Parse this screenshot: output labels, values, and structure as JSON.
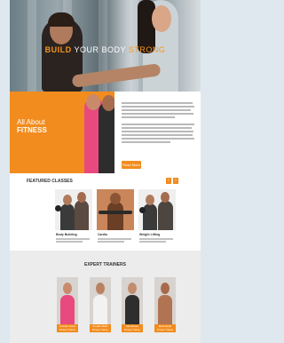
{
  "hero": {
    "title_part1": "BUILD",
    "title_part2": "YOUR BODY",
    "title_part3": "STRONG"
  },
  "about": {
    "title_line1": "All About",
    "title_line2": "FITNESS",
    "button_label": "Read More"
  },
  "featured": {
    "title": "FEATURED CLASSES",
    "prev_icon": "‹",
    "next_icon": "›",
    "classes": [
      {
        "name": "Body Building"
      },
      {
        "name": "Cardio"
      },
      {
        "name": "Weight Lifting"
      }
    ]
  },
  "trainers": {
    "title": "EXPERT TRAINERS",
    "items": [
      {
        "name": "Jennifer Jones",
        "role": "Fitness Trainer"
      },
      {
        "name": "Ronald Walsh",
        "role": "Fitness Trainer"
      },
      {
        "name": "Kate Brown",
        "role": "Fitness Trainer"
      },
      {
        "name": "Mark Smith",
        "role": "Fitness Trainer"
      }
    ]
  },
  "colors": {
    "accent": "#f28c1e",
    "page_background": "#dfe8ef"
  }
}
